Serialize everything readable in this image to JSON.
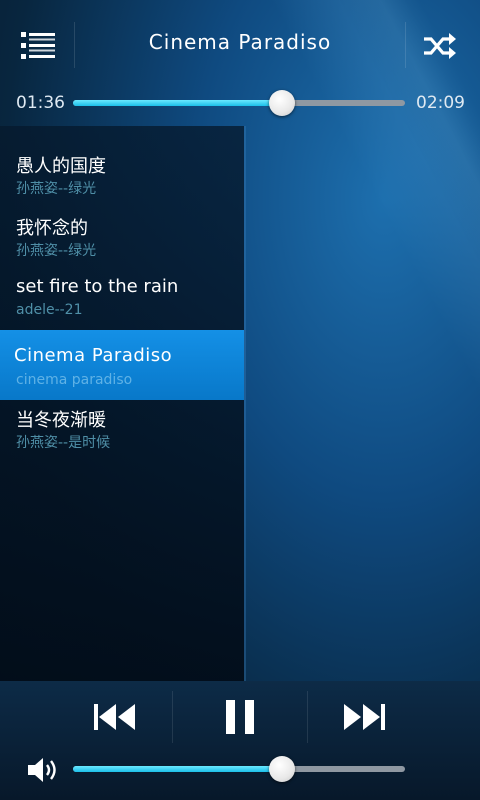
{
  "header": {
    "title": "Cinema Paradiso",
    "menu_icon": "list-icon",
    "shuffle_icon": "shuffle-icon"
  },
  "progress": {
    "current": "01:36",
    "total": "02:09",
    "fraction": 0.63
  },
  "playlist": [
    {
      "title": "愚人的国度",
      "artist": "孙燕姿--绿光",
      "active": false
    },
    {
      "title": "我怀念的",
      "artist": "孙燕姿--绿光",
      "active": false
    },
    {
      "title": "set fire to the rain",
      "artist": "adele--21",
      "active": false
    },
    {
      "title": "Cinema Paradiso",
      "artist": "cinema paradiso",
      "active": true
    },
    {
      "title": "当冬夜渐暖",
      "artist": "孙燕姿--是时候",
      "active": false
    }
  ],
  "controls": {
    "prev_icon": "skip-previous-icon",
    "pause_icon": "pause-icon",
    "next_icon": "skip-next-icon"
  },
  "volume": {
    "icon": "speaker-icon",
    "fraction": 0.63
  },
  "colors": {
    "accent": "#1bbfe9",
    "active_row": "#0c85d6"
  }
}
